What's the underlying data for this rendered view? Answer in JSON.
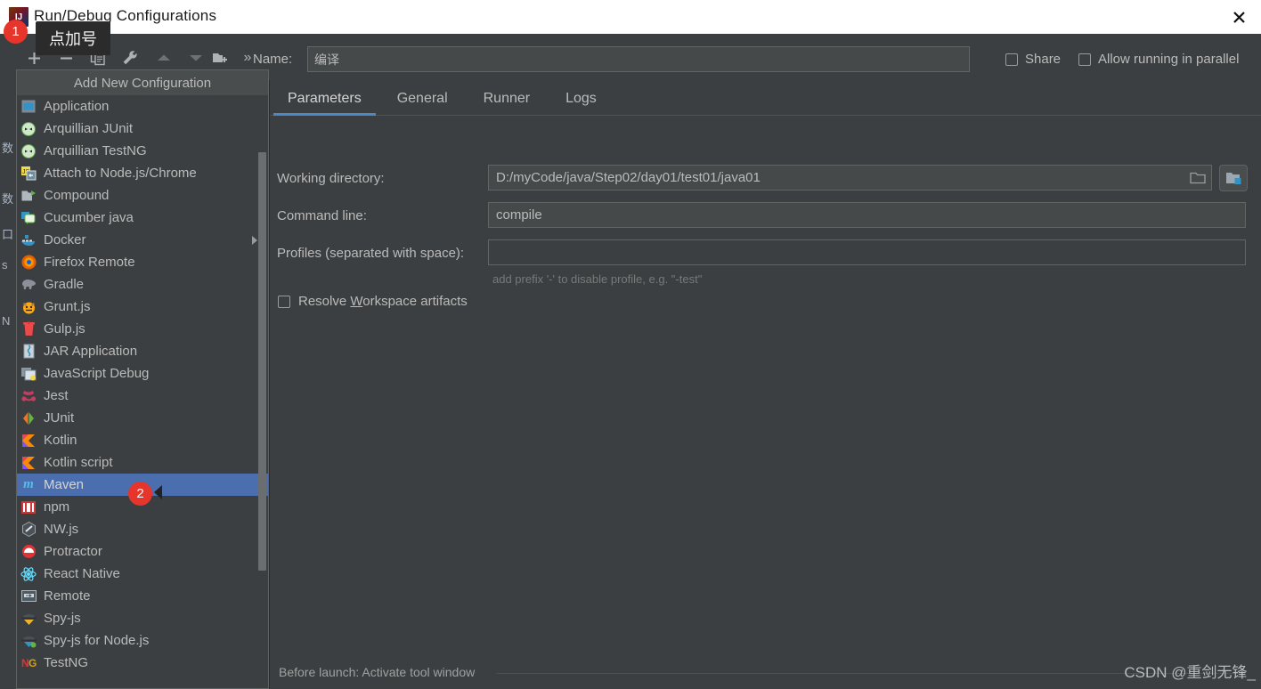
{
  "window": {
    "title": "Run/Debug Configurations",
    "logo_icon": "intellij-idea-logo-icon",
    "close_icon": "close-icon"
  },
  "toolbar": {
    "add_label": "+",
    "remove_label": "−",
    "copy_icon": "copy-icon",
    "edit_templates_icon": "wrench-icon",
    "move_up_icon": "arrow-up-icon",
    "move_down_icon": "arrow-down-icon",
    "new_folder_icon": "folder-add-icon",
    "overflow_label": "»"
  },
  "name": {
    "label": "Name:",
    "value": "编译",
    "placeholder": ""
  },
  "options": {
    "share": {
      "label": "Share",
      "checked": false
    },
    "parallel": {
      "label": "Allow running in parallel",
      "checked": false
    }
  },
  "popup": {
    "title": "Add New Configuration",
    "selected": "Maven",
    "items": [
      {
        "label": "Application",
        "icon": "application-icon",
        "submenu": false
      },
      {
        "label": "Arquillian JUnit",
        "icon": "arquillian-junit-icon",
        "submenu": false
      },
      {
        "label": "Arquillian TestNG",
        "icon": "arquillian-testng-icon",
        "submenu": false
      },
      {
        "label": "Attach to Node.js/Chrome",
        "icon": "nodejs-attach-icon",
        "submenu": false
      },
      {
        "label": "Compound",
        "icon": "compound-folder-icon",
        "submenu": false
      },
      {
        "label": "Cucumber java",
        "icon": "cucumber-java-icon",
        "submenu": false
      },
      {
        "label": "Docker",
        "icon": "docker-whale-icon",
        "submenu": true
      },
      {
        "label": "Firefox Remote",
        "icon": "firefox-icon",
        "submenu": false
      },
      {
        "label": "Gradle",
        "icon": "gradle-elephant-icon",
        "submenu": false
      },
      {
        "label": "Grunt.js",
        "icon": "grunt-icon",
        "submenu": false
      },
      {
        "label": "Gulp.js",
        "icon": "gulp-icon",
        "submenu": false
      },
      {
        "label": "JAR Application",
        "icon": "jar-icon",
        "submenu": false
      },
      {
        "label": "JavaScript Debug",
        "icon": "javascript-debug-icon",
        "submenu": false
      },
      {
        "label": "Jest",
        "icon": "jest-icon",
        "submenu": false
      },
      {
        "label": "JUnit",
        "icon": "junit-icon",
        "submenu": false
      },
      {
        "label": "Kotlin",
        "icon": "kotlin-icon",
        "submenu": false
      },
      {
        "label": "Kotlin script",
        "icon": "kotlin-script-icon",
        "submenu": false
      },
      {
        "label": "Maven",
        "icon": "maven-icon",
        "submenu": false
      },
      {
        "label": "npm",
        "icon": "npm-icon",
        "submenu": false
      },
      {
        "label": "NW.js",
        "icon": "nwjs-icon",
        "submenu": false
      },
      {
        "label": "Protractor",
        "icon": "protractor-icon",
        "submenu": false
      },
      {
        "label": "React Native",
        "icon": "react-native-icon",
        "submenu": false
      },
      {
        "label": "Remote",
        "icon": "remote-icon",
        "submenu": false
      },
      {
        "label": "Spy-js",
        "icon": "spyjs-icon",
        "submenu": false
      },
      {
        "label": "Spy-js for Node.js",
        "icon": "spyjs-node-icon",
        "submenu": false
      },
      {
        "label": "TestNG",
        "icon": "testng-icon",
        "submenu": false
      }
    ]
  },
  "tabs": [
    {
      "label": "Parameters",
      "active": true
    },
    {
      "label": "General",
      "active": false
    },
    {
      "label": "Runner",
      "active": false
    },
    {
      "label": "Logs",
      "active": false
    }
  ],
  "form": {
    "working_directory": {
      "label": "Working directory:",
      "value": "D:/myCode/java/Step02/day01/test01/java01",
      "browse_icon": "folder-browse-icon",
      "module_icon": "module-folder-icon"
    },
    "command_line": {
      "label": "Command line:",
      "value": "compile",
      "placeholder": ""
    },
    "profiles": {
      "label": "Profiles (separated with space):",
      "value": "",
      "hint": "add prefix '-' to disable profile, e.g. \"-test\""
    },
    "resolve_workspace": {
      "label_pre": "Resolve ",
      "label_underlined": "W",
      "label_post": "orkspace artifacts",
      "checked": false
    }
  },
  "before_launch": {
    "text": "Before launch: Activate tool window"
  },
  "watermark": "CSDN @重剑无锋_",
  "annotations": {
    "tooltip": "点加号",
    "badge_1": "1",
    "badge_2": "2"
  },
  "bg_fragments": [
    "数",
    "数",
    "口",
    "s",
    "▸",
    "N"
  ],
  "colors": {
    "window_bg": "#3c3f41",
    "selection": "#4b6eaf",
    "accent": "#4a88c7",
    "badge": "#e8352b",
    "text": "#bbbbbb",
    "titlebar": "#ffffff"
  }
}
